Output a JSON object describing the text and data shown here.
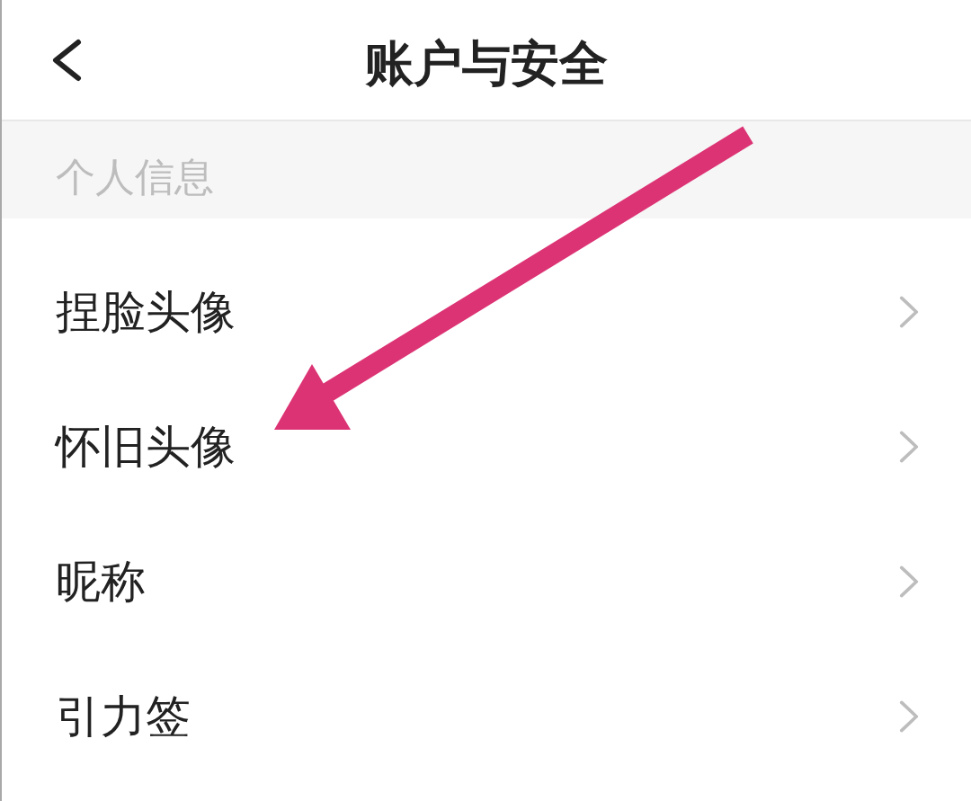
{
  "header": {
    "title": "账户与安全"
  },
  "section": {
    "title": "个人信息"
  },
  "items": [
    {
      "label": "捏脸头像"
    },
    {
      "label": "怀旧头像"
    },
    {
      "label": "昵称"
    },
    {
      "label": "引力签"
    }
  ]
}
